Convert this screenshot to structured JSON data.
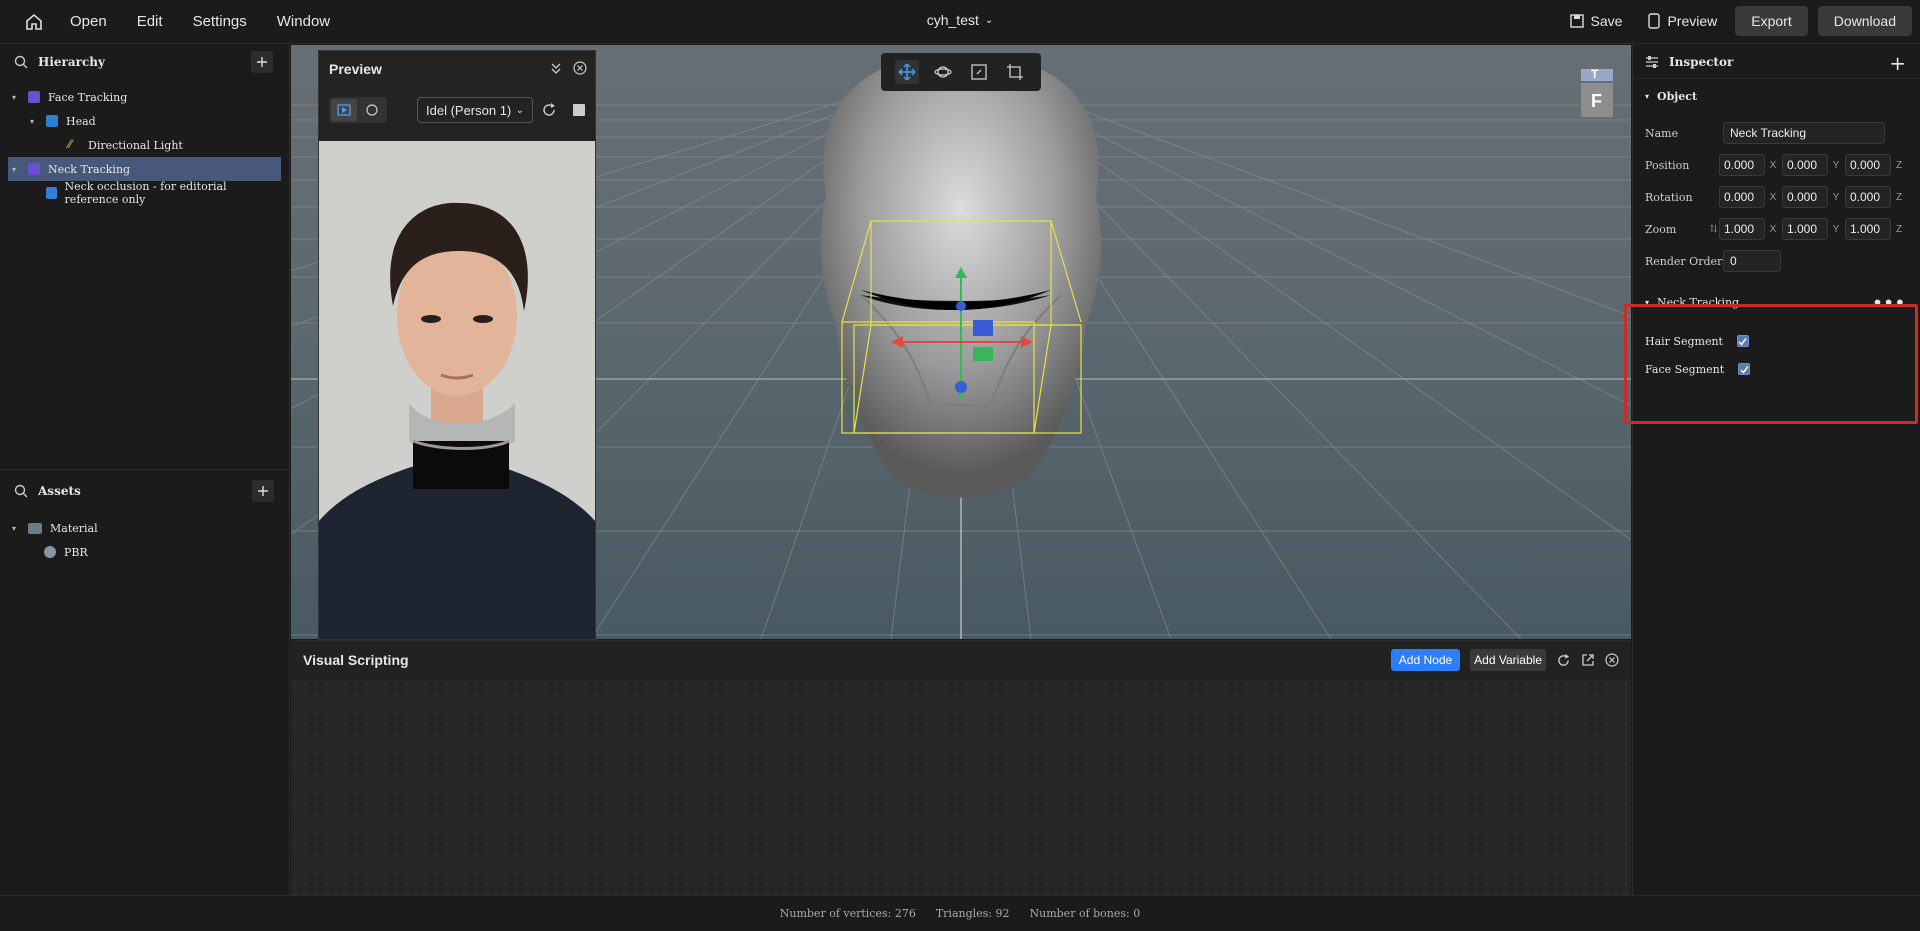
{
  "menu": {
    "open": "Open",
    "edit": "Edit",
    "settings": "Settings",
    "window": "Window"
  },
  "project": {
    "name": "cyh_test"
  },
  "toolbar": {
    "save": "Save",
    "preview": "Preview",
    "export": "Export",
    "download": "Download"
  },
  "hierarchy": {
    "title": "Hierarchy",
    "items": [
      {
        "label": "Face Tracking"
      },
      {
        "label": "Head"
      },
      {
        "label": "Directional Light"
      },
      {
        "label": "Neck Tracking"
      },
      {
        "label": "Neck occlusion - for editorial reference only"
      }
    ]
  },
  "assets": {
    "title": "Assets",
    "items": [
      {
        "label": "Material"
      },
      {
        "label": "PBR"
      }
    ]
  },
  "previewPanel": {
    "title": "Preview",
    "select": "Idel (Person 1)"
  },
  "viewCube": {
    "top": "T",
    "front": "F"
  },
  "visualScripting": {
    "title": "Visual Scripting",
    "addNode": "Add Node",
    "addVariable": "Add Variable"
  },
  "inspector": {
    "title": "Inspector",
    "objectSection": "Object",
    "name": {
      "label": "Name",
      "value": "Neck Tracking"
    },
    "position": {
      "label": "Position",
      "x": "0.000",
      "y": "0.000",
      "z": "0.000"
    },
    "rotation": {
      "label": "Rotation",
      "x": "0.000",
      "y": "0.000",
      "z": "0.000"
    },
    "zoom": {
      "label": "Zoom",
      "x": "1.000",
      "y": "1.000",
      "z": "1.000"
    },
    "renderOrder": {
      "label": "Render Order",
      "value": "0"
    },
    "axisX": "X",
    "axisY": "Y",
    "axisZ": "Z",
    "neckSection": "Neck Tracking",
    "hairSegment": "Hair Segment",
    "faceSegment": "Face Segment"
  },
  "status": {
    "vertices": "Number of vertices: 276",
    "triangles": "Triangles: 92",
    "bones": "Number of bones: 0"
  },
  "colors": {
    "selected": "#47587a",
    "accent": "#2d7ff9",
    "highlight": "#c92a2a"
  }
}
